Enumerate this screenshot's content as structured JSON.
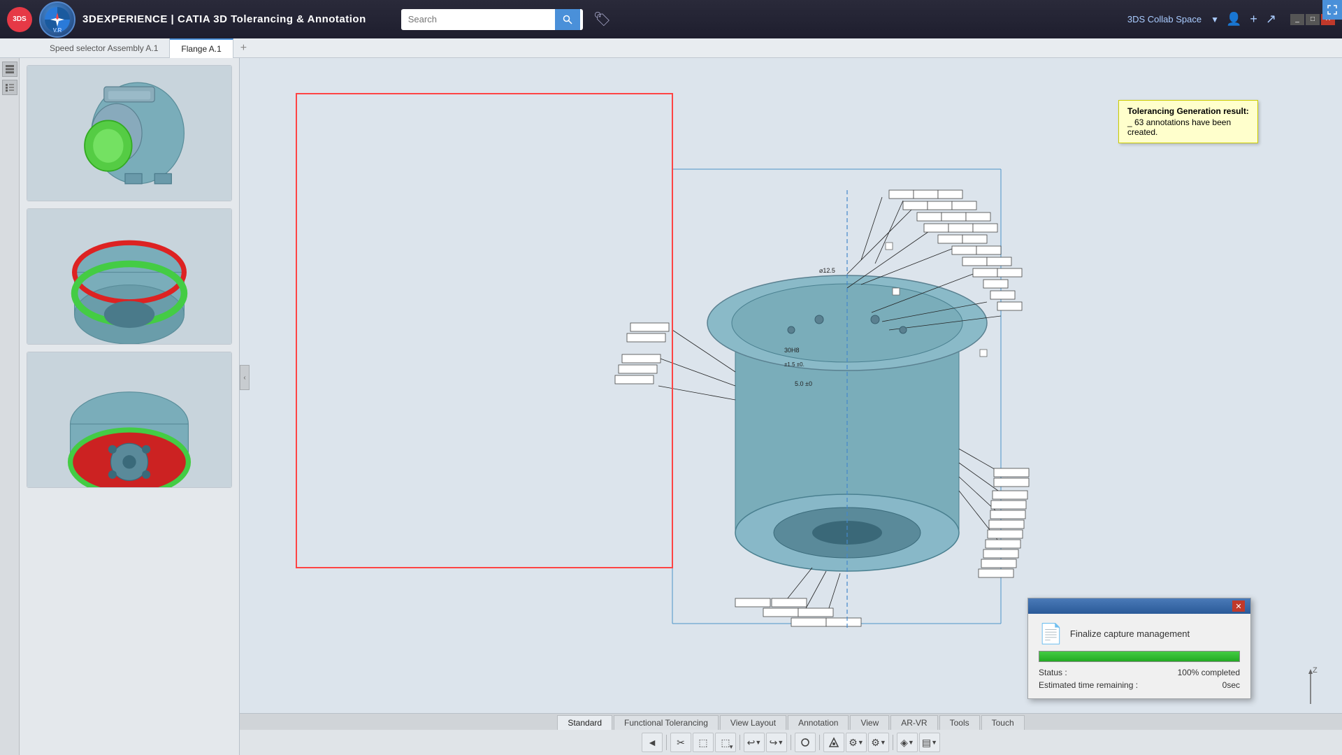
{
  "app": {
    "logo_text": "3DS",
    "title_prefix": "3D",
    "title_main": "EXPERIENCE",
    "title_separator": " | ",
    "title_product": "CATIA 3D Tolerancing & Annotation",
    "compass_label": "V.R"
  },
  "search": {
    "placeholder": "Search",
    "value": ""
  },
  "collab_space": {
    "label": "3DS Collab Space"
  },
  "tabs": [
    {
      "label": "Speed selector Assembly A.1",
      "active": false
    },
    {
      "label": "Flange A.1",
      "active": true
    }
  ],
  "toolbar_tabs": [
    {
      "label": "Standard",
      "active": true
    },
    {
      "label": "Functional Tolerancing",
      "active": false
    },
    {
      "label": "View Layout",
      "active": false
    },
    {
      "label": "Annotation",
      "active": false
    },
    {
      "label": "View",
      "active": false
    },
    {
      "label": "AR-VR",
      "active": false
    },
    {
      "label": "Tools",
      "active": false
    },
    {
      "label": "Touch",
      "active": false
    }
  ],
  "annotation_tooltip": {
    "line1": "Tolerancing Generation result:",
    "line2": "_ 63 annotations have been created."
  },
  "progress_dialog": {
    "title": "Finalize capture management",
    "status_label": "Status :",
    "status_value": "100% completed",
    "time_label": "Estimated time remaining :",
    "time_value": "0sec",
    "progress_percent": 100
  },
  "axis": {
    "label": "Z"
  },
  "tools": [
    {
      "icon": "✂",
      "name": "cut-tool"
    },
    {
      "icon": "⬚",
      "name": "copy-tool"
    },
    {
      "icon": "⬚",
      "name": "paste-tool"
    },
    {
      "icon": "↩",
      "name": "undo-tool"
    },
    {
      "icon": "↪",
      "name": "redo-tool"
    },
    {
      "icon": "⊕",
      "name": "rotate-tool"
    },
    {
      "icon": "⬡",
      "name": "snap-tool"
    },
    {
      "icon": "⚙",
      "name": "settings-tool"
    },
    {
      "icon": "⚙",
      "name": "options-tool"
    },
    {
      "icon": "◈",
      "name": "view-tool"
    },
    {
      "icon": "▤",
      "name": "display-tool"
    }
  ]
}
